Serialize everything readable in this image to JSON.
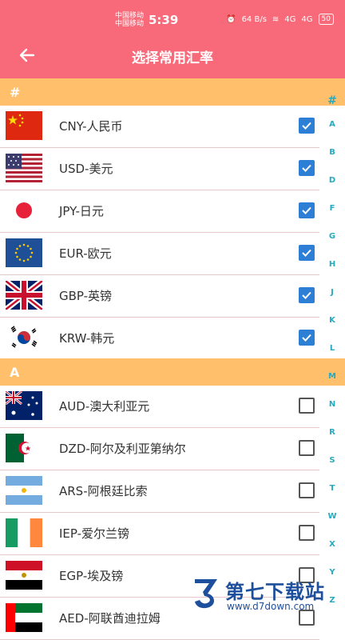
{
  "status_bar": {
    "carrier_1": "中国移动",
    "carrier_2": "中国移动",
    "time": "5:39",
    "net_speed": "64 B/s",
    "signal_1": "4G",
    "signal_2": "4G",
    "battery": "50"
  },
  "header": {
    "title": "选择常用汇率",
    "back_icon": "back-arrow-icon"
  },
  "sections": [
    {
      "letter": "#",
      "items": [
        {
          "label": "CNY-人民币",
          "checked": true
        },
        {
          "label": "USD-美元",
          "checked": true
        },
        {
          "label": "JPY-日元",
          "checked": true
        },
        {
          "label": "EUR-欧元",
          "checked": true
        },
        {
          "label": "GBP-英镑",
          "checked": true
        },
        {
          "label": "KRW-韩元",
          "checked": true
        }
      ]
    },
    {
      "letter": "A",
      "items": [
        {
          "label": "AUD-澳大利亚元",
          "checked": false
        },
        {
          "label": "DZD-阿尔及利亚第纳尔",
          "checked": false
        },
        {
          "label": "ARS-阿根廷比索",
          "checked": false
        },
        {
          "label": "IEP-爱尔兰镑",
          "checked": false
        },
        {
          "label": "EGP-埃及镑",
          "checked": false
        },
        {
          "label": "AED-阿联酋迪拉姆",
          "checked": false
        }
      ]
    }
  ],
  "index_letters": [
    "#",
    "A",
    "B",
    "D",
    "F",
    "G",
    "H",
    "J",
    "K",
    "L",
    "M",
    "N",
    "R",
    "S",
    "T",
    "W",
    "X",
    "Y",
    "Z"
  ],
  "watermark": {
    "name": "第七下载站",
    "url": "www.d7down.com"
  },
  "colors": {
    "primary": "#f86a7a",
    "section": "#ffbf6b",
    "checkbox": "#2d7fd6",
    "index": "#27aabf"
  }
}
